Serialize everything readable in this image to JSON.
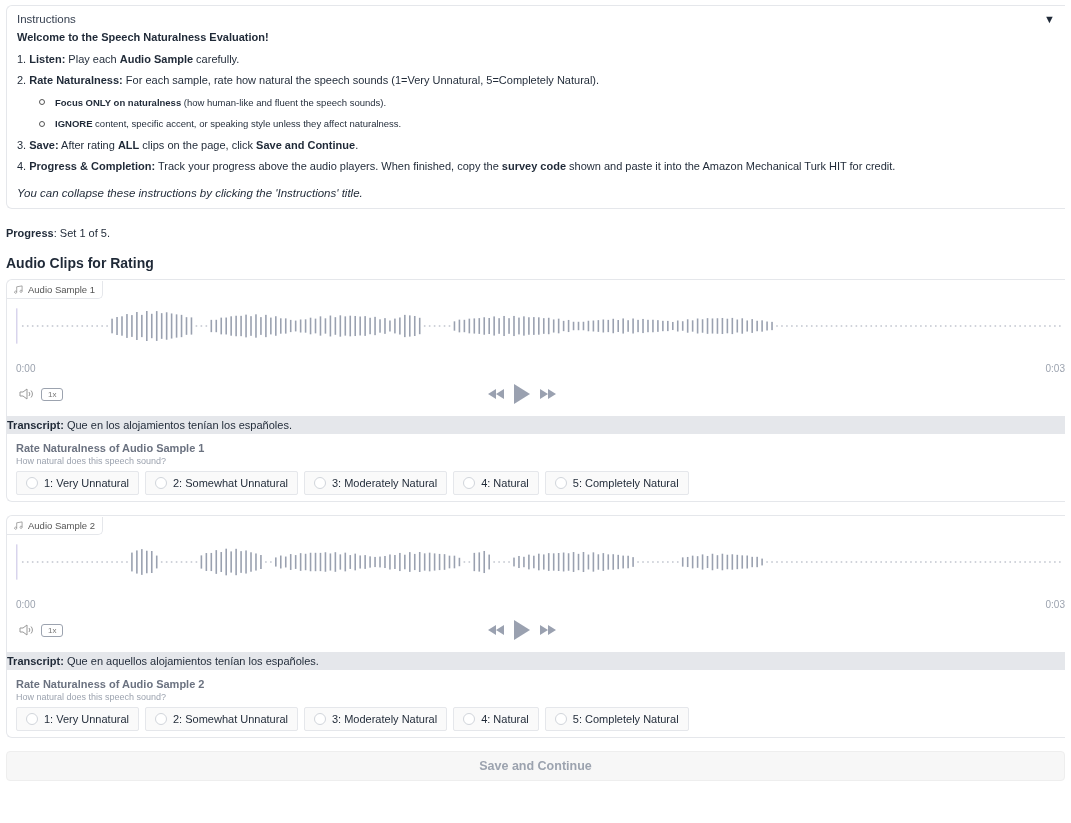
{
  "instructions": {
    "title": "Instructions",
    "toggle": "▼",
    "expanded": true,
    "paragraphs": [
      {
        "kind": "heading",
        "text": "Welcome to the Speech Naturalness Evaluation!"
      },
      {
        "kind": "step",
        "text": "1. **Listen:** Play each **Audio Sample** carefully."
      },
      {
        "kind": "step",
        "text": "2. **Rate Naturalness:** For each sample, rate how natural the speech sounds (1=Very Unnatural, 5=Completely Natural)."
      },
      {
        "kind": "bullet",
        "text": "**Focus ONLY on naturalness** (how human-like and fluent the speech sounds)."
      },
      {
        "kind": "bullet",
        "text": "**IGNORE** content, specific accent, or speaking style unless they affect naturalness."
      },
      {
        "kind": "step",
        "text": "3. **Save:** After rating **ALL** clips on the page, click **Save and Continue**."
      },
      {
        "kind": "step",
        "text": "4. **Progress & Completion:** Track your progress above the audio players. When finished, copy the **survey code** shown and paste it into the Amazon Mechanical Turk HIT for credit."
      },
      {
        "kind": "note",
        "text": "You can collapse these instructions by clicking the 'Instructions' title."
      }
    ]
  },
  "progress": "**Progress**: Set 1 of 5.",
  "section_title": "Audio Clips for Rating",
  "samples": [
    {
      "label": "Audio Sample 1",
      "time_start": "0:00",
      "time_end": "0:03",
      "speed": "1x",
      "transcript": "**Transcript:** Que en los alojamientos tenían los españoles.",
      "rating_title": "Rate Naturalness of Audio Sample 1",
      "rating_hint": "How natural does this speech sound?",
      "options": [
        {
          "label": "1: Very Unnatural",
          "selected": false
        },
        {
          "label": "2: Somewhat Unnatural",
          "selected": false
        },
        {
          "label": "3: Moderately Natural",
          "selected": false
        },
        {
          "label": "4: Natural",
          "selected": false
        },
        {
          "label": "5: Completely Natural",
          "selected": false
        }
      ]
    },
    {
      "label": "Audio Sample 2",
      "time_start": "0:00",
      "time_end": "0:03",
      "speed": "1x",
      "transcript": "**Transcript:** Que en aquellos alojamientos tenían los españoles.",
      "rating_title": "Rate Naturalness of Audio Sample 2",
      "rating_hint": "How natural does this speech sound?",
      "options": [
        {
          "label": "1: Very Unnatural",
          "selected": false
        },
        {
          "label": "2: Somewhat Unnatural",
          "selected": false
        },
        {
          "label": "3: Moderately Natural",
          "selected": false
        },
        {
          "label": "4: Natural",
          "selected": false
        },
        {
          "label": "5: Completely Natural",
          "selected": false
        }
      ]
    }
  ],
  "save_button": {
    "label": "Save and Continue",
    "disabled": true
  }
}
